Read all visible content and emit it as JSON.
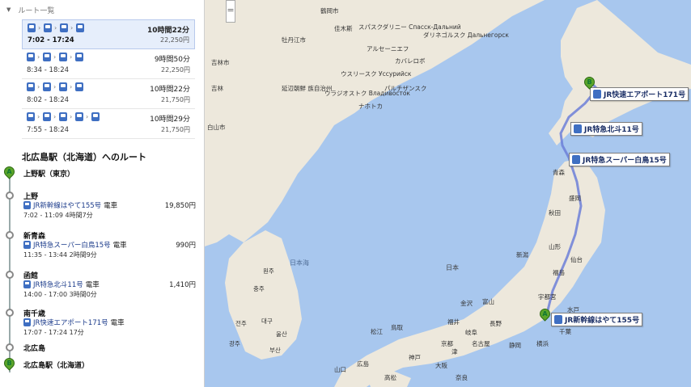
{
  "routes_header": "ルート一覧",
  "route_options": [
    {
      "times": "7:02 - 17:24",
      "duration": "10時間22分",
      "fare": "22,250円",
      "icons": 4,
      "selected": true
    },
    {
      "times": "8:34 - 18:24",
      "duration": "9時間50分",
      "fare": "22,250円",
      "icons": 4,
      "selected": false
    },
    {
      "times": "8:02 - 18:24",
      "duration": "10時間22分",
      "fare": "21,750円",
      "icons": 4,
      "selected": false
    },
    {
      "times": "7:55 - 18:24",
      "duration": "10時間29分",
      "fare": "21,750円",
      "icons": 5,
      "selected": false
    }
  ],
  "route_heading": "北広島駅（北海道）へのルート",
  "start": {
    "marker": "A",
    "name": "上野駅（東京）"
  },
  "steps": [
    {
      "name": "上野",
      "train": "JR新幹線はやて155号",
      "type": "電車",
      "time": "7:02 - 11:09 4時間7分",
      "fare": "19,850円"
    },
    {
      "name": "新青森",
      "train": "JR特急スーパー白鳥15号",
      "type": "電車",
      "time": "11:35 - 13:44 2時間9分",
      "fare": "990円"
    },
    {
      "name": "函館",
      "train": "JR特急北斗11号",
      "type": "電車",
      "time": "14:00 - 17:00 3時間0分",
      "fare": "1,410円"
    },
    {
      "name": "南千歳",
      "train": "JR快速エアポート171号",
      "type": "電車",
      "time": "17:07 - 17:24 17分",
      "fare": ""
    },
    {
      "name": "北広島",
      "train": "",
      "type": "",
      "time": "",
      "fare": ""
    }
  ],
  "end": {
    "marker": "B",
    "name": "北広島駅（北海道）"
  },
  "map": {
    "callouts": [
      "JR快速エアポート171号",
      "JR特急北斗11号",
      "JR特急スーパー白鳥15号",
      "JR新幹線はやて155号"
    ],
    "pin_a": "A",
    "pin_b": "B",
    "place_labels": {
      "hegang": "鶴岡市",
      "jiamusi": "佳木斯",
      "mudanjiang": "牡丹江市",
      "jilin_city": "吉林市",
      "jilin": "吉林",
      "changchun": "長春市",
      "baishan": "白山市",
      "yanbian": "延辺朝鮮\n族自治州",
      "vladivostok": "ウラジオストク\nВладивосток",
      "ussuriysk": "ウスリースク\nУссурийск",
      "spassk": "スパスクダリニー\nСпасск-Дальний",
      "arsenyev": "アルセーニエフ",
      "partizansk": "パルチザンスク",
      "nakhodka": "ナホトカ",
      "dalnegorsk": "ダリネゴルスク\nДальнегорск",
      "kavalerovo": "カバレロボ",
      "sea_japan": "日本海",
      "japan": "日本",
      "sapporo": "札幌",
      "hakodate": "函館",
      "aomori": "青森",
      "akita": "秋田",
      "morioka": "盛岡",
      "sendai": "仙台",
      "yamagata": "山形",
      "niigata": "新潟",
      "fukushima": "福島",
      "utsunomiya": "宇都宮",
      "mito": "水戸",
      "chiba": "千葉",
      "yokohama": "横浜",
      "shizuoka": "静岡",
      "nagoya": "名古屋",
      "nagano": "長野",
      "kyoto": "京都",
      "osaka": "大阪",
      "kobe": "神戸",
      "hiroshima": "広島",
      "matsue": "松江",
      "tottori": "鳥取",
      "kanazawa": "金沢",
      "fukui": "福井",
      "gifu": "岐阜",
      "toyama": "富山",
      "yamaguchi": "山口",
      "takamatsu": "高松",
      "ulsan": "울산",
      "busan": "부산",
      "daegu": "대구",
      "seoul_area": "충주",
      "korea_n": "원주",
      "jeonju": "전주",
      "gwangju": "광주",
      "tsu": "津",
      "nara": "奈良",
      "wakayama": "和歌山",
      "kagawa": "徳島",
      "kochi": "高知",
      "saga": "佐賀"
    }
  }
}
